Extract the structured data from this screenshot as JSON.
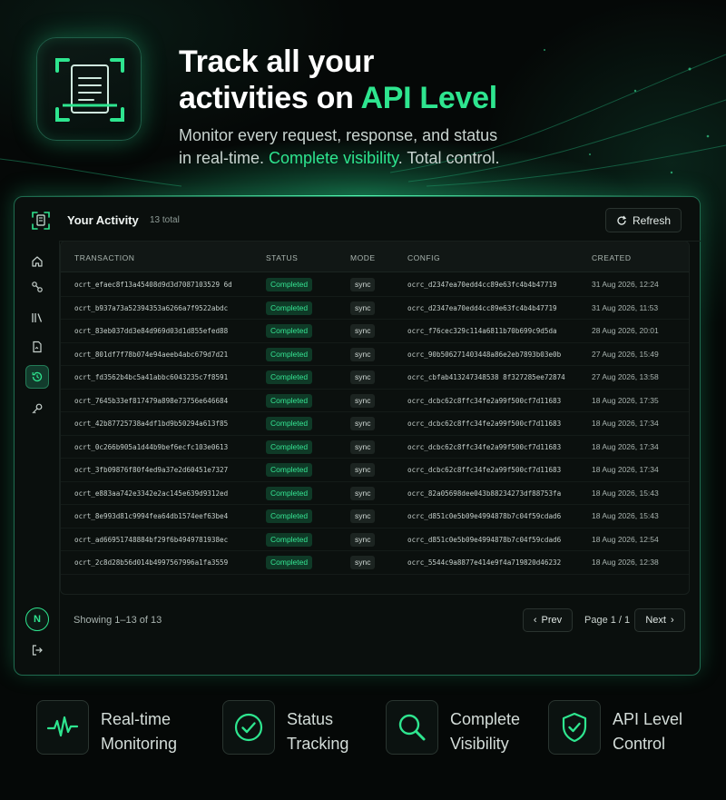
{
  "hero": {
    "title_line1": "Track all your",
    "title_line2_prefix": "activities on ",
    "title_line2_accent": "API Level",
    "sub_line1": "Monitor every request, response, and status",
    "sub_line2_prefix": "in real-time. ",
    "sub_line2_accent": "Complete visibility",
    "sub_line2_suffix": ". Total control."
  },
  "colors": {
    "accent": "#2ee58f",
    "background": "#050807",
    "panel": "#0a0f0d",
    "badge_bg": "#0f3a27"
  },
  "panel": {
    "title": "Your Activity",
    "count": "13 total",
    "refresh_label": "Refresh",
    "refresh_icon": "refresh-icon"
  },
  "sidebar": {
    "items": [
      {
        "icon": "home-icon"
      },
      {
        "icon": "integrations-icon"
      },
      {
        "icon": "library-icon"
      },
      {
        "icon": "document-icon"
      },
      {
        "icon": "history-icon",
        "active": true
      },
      {
        "icon": "key-icon"
      }
    ],
    "avatar_initial": "N",
    "logout_icon": "logout-icon"
  },
  "table": {
    "columns": [
      "TRANSACTION",
      "STATUS",
      "MODE",
      "CONFIG",
      "CREATED"
    ],
    "rows": [
      {
        "transaction": "ocrt_efaec8f13a45408d9d3d7087103529 6d",
        "status": "Completed",
        "mode": "sync",
        "config": "ocrc_d2347ea70edd4cc89e63fc4b4b47719",
        "created": "31 Aug 2026, 12:24"
      },
      {
        "transaction": "ocrt_b937a73a52394353a6266a7f9522abdc",
        "status": "Completed",
        "mode": "sync",
        "config": "ocrc_d2347ea70edd4cc89e63fc4b4b47719",
        "created": "31 Aug 2026, 11:53"
      },
      {
        "transaction": "ocrt_83eb037dd3e84d969d03d1d855efed88",
        "status": "Completed",
        "mode": "sync",
        "config": "ocrc_f76cec329c114a6811b70b699c9d5da",
        "created": "28 Aug 2026, 20:01"
      },
      {
        "transaction": "ocrt_801df7f78b074e94aeeb4abc679d7d21",
        "status": "Completed",
        "mode": "sync",
        "config": "ocrc_90b506271403448a86e2eb7893b03e0b",
        "created": "27 Aug 2026, 15:49"
      },
      {
        "transaction": "ocrt_fd3562b4bc5a41abbc6043235c7f8591",
        "status": "Completed",
        "mode": "sync",
        "config": "ocrc_cbfab413247348538 8f327285ee72874",
        "created": "27 Aug 2026, 13:58"
      },
      {
        "transaction": "ocrt_7645b33ef817479a898e73756e646684",
        "status": "Completed",
        "mode": "sync",
        "config": "ocrc_dcbc62c8ffc34fe2a99f500cf7d11683",
        "created": "18 Aug 2026, 17:35"
      },
      {
        "transaction": "ocrt_42b87725738a4df1bd9b50294a613f85",
        "status": "Completed",
        "mode": "sync",
        "config": "ocrc_dcbc62c8ffc34fe2a99f500cf7d11683",
        "created": "18 Aug 2026, 17:34"
      },
      {
        "transaction": "ocrt_0c266b905a1d44b9bef6ecfc103e0613",
        "status": "Completed",
        "mode": "sync",
        "config": "ocrc_dcbc62c8ffc34fe2a99f500cf7d11683",
        "created": "18 Aug 2026, 17:34"
      },
      {
        "transaction": "ocrt_3fb09876f80f4ed9a37e2d60451e7327",
        "status": "Completed",
        "mode": "sync",
        "config": "ocrc_dcbc62c8ffc34fe2a99f500cf7d11683",
        "created": "18 Aug 2026, 17:34"
      },
      {
        "transaction": "ocrt_e883aa742e3342e2ac145e639d9312ed",
        "status": "Completed",
        "mode": "sync",
        "config": "ocrc_82a05698dee043b88234273df88753fa",
        "created": "18 Aug 2026, 15:43"
      },
      {
        "transaction": "ocrt_8e993d81c9994fea64db1574eef63be4",
        "status": "Completed",
        "mode": "sync",
        "config": "ocrc_d851c0e5b09e4994878b7c04f59cdad6",
        "created": "18 Aug 2026, 15:43"
      },
      {
        "transaction": "ocrt_ad66951748884bf29f6b4949781938ec",
        "status": "Completed",
        "mode": "sync",
        "config": "ocrc_d851c0e5b09e4994878b7c04f59cdad6",
        "created": "18 Aug 2026, 12:54"
      },
      {
        "transaction": "ocrt_2c8d28b56d014b4997567996a1fa3559",
        "status": "Completed",
        "mode": "sync",
        "config": "ocrc_5544c9a8877e414e9f4a719820d46232",
        "created": "18 Aug 2026, 12:38"
      }
    ]
  },
  "pagination": {
    "showing": "Showing 1–13 of 13",
    "prev_label": "Prev",
    "page_label": "Page 1 / 1",
    "next_label": "Next"
  },
  "features": [
    {
      "icon": "pulse-icon",
      "line1": "Real-time",
      "line2": "Monitoring"
    },
    {
      "icon": "check-circle-icon",
      "line1": "Status",
      "line2": "Tracking"
    },
    {
      "icon": "search-icon",
      "line1": "Complete",
      "line2": "Visibility"
    },
    {
      "icon": "shield-check-icon",
      "line1": "API Level",
      "line2": "Control"
    }
  ]
}
